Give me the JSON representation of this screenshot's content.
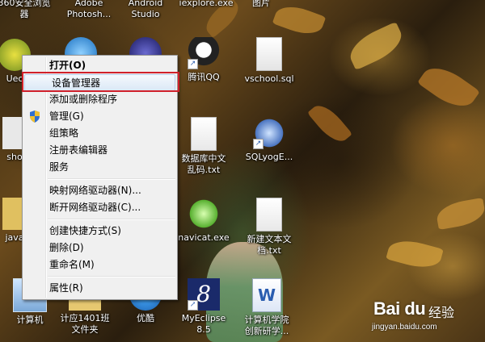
{
  "desktop": {
    "top_row_labels": [
      "360安全浏览\n器",
      "Adobe\nPhotosh...",
      "Android\nStudio",
      "iexplore.exe",
      "图片"
    ],
    "icons": [
      {
        "id": "uec",
        "label": "Uec"
      },
      {
        "id": "sho",
        "label": "sho"
      },
      {
        "id": "java",
        "label": "java"
      },
      {
        "id": "computer",
        "label": "计算机"
      },
      {
        "id": "class1401",
        "label": "计应1401班\n文件夹"
      },
      {
        "id": "youku",
        "label": "优酷"
      },
      {
        "id": "qq",
        "label": "腾讯QQ"
      },
      {
        "id": "vschool",
        "label": "vschool.sql"
      },
      {
        "id": "dbtxt",
        "label": "数据库中文\n乱码.txt"
      },
      {
        "id": "sqlyog",
        "label": "SQLyogE..."
      },
      {
        "id": "navicat",
        "label": "navicat.exe"
      },
      {
        "id": "newtxt",
        "label": "新建文本文\n档.txt"
      },
      {
        "id": "myeclipse",
        "label": "MyEclipse\n8.5"
      },
      {
        "id": "word",
        "label": "计算机学院\n创新研学..."
      }
    ]
  },
  "context_menu": {
    "items": [
      {
        "label": "打开(O)",
        "bold": true
      },
      {
        "label": "设备管理器",
        "highlighted": true
      },
      {
        "label": "添加或删除程序"
      },
      {
        "label": "管理(G)",
        "uac_shield": true
      },
      {
        "label": "组策略"
      },
      {
        "label": "注册表编辑器"
      },
      {
        "label": "服务"
      },
      {
        "label": "映射网络驱动器(N)..."
      },
      {
        "label": "断开网络驱动器(C)..."
      },
      {
        "label": "创建快捷方式(S)"
      },
      {
        "label": "删除(D)"
      },
      {
        "label": "重命名(M)"
      },
      {
        "label": "属性(R)"
      }
    ]
  },
  "watermark": {
    "brand": "Bai du",
    "brand_cn": "经验",
    "url": "jingyan.baidu.com"
  },
  "colors": {
    "highlight_box": "#d0202a",
    "menu_bg": "#f0f0f0"
  }
}
